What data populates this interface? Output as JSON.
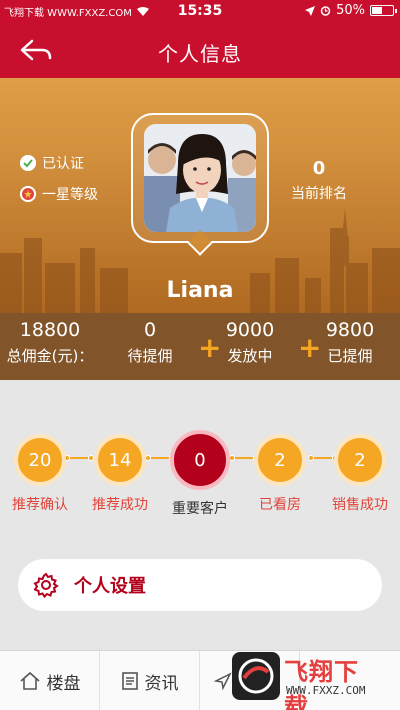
{
  "status_bar": {
    "watermark": "飞翔下载 WWW.FXXZ.COM",
    "time": "15:35",
    "battery": "50%"
  },
  "nav": {
    "title": "个人信息"
  },
  "profile": {
    "verified": "已认证",
    "level": "一星等级",
    "rank_value": "0",
    "rank_label": "当前排名",
    "name": "Liana"
  },
  "stats": [
    {
      "value": "18800",
      "label": "总佣金(元)："
    },
    {
      "value": "0",
      "label": "待提佣"
    },
    {
      "value": "9000",
      "label": "发放中"
    },
    {
      "value": "9800",
      "label": "已提佣"
    }
  ],
  "steps": [
    {
      "value": "20",
      "label": "推荐确认"
    },
    {
      "value": "14",
      "label": "推荐成功"
    },
    {
      "value": "0",
      "label": "重要客户"
    },
    {
      "value": "2",
      "label": "已看房"
    },
    {
      "value": "2",
      "label": "销售成功"
    }
  ],
  "settings": {
    "label": "个人设置"
  },
  "tabs": [
    {
      "label": "楼盘",
      "icon": "home-icon"
    },
    {
      "label": "资讯",
      "icon": "news-icon"
    },
    {
      "label": "",
      "icon": "send-icon"
    }
  ],
  "watermark_logo": {
    "big": "飞翔下载",
    "small": "WWW.FXXZ.COM"
  },
  "colors": {
    "brand_red": "#c8102e",
    "accent_orange": "#f5a623",
    "dark_red": "#b3001b"
  }
}
